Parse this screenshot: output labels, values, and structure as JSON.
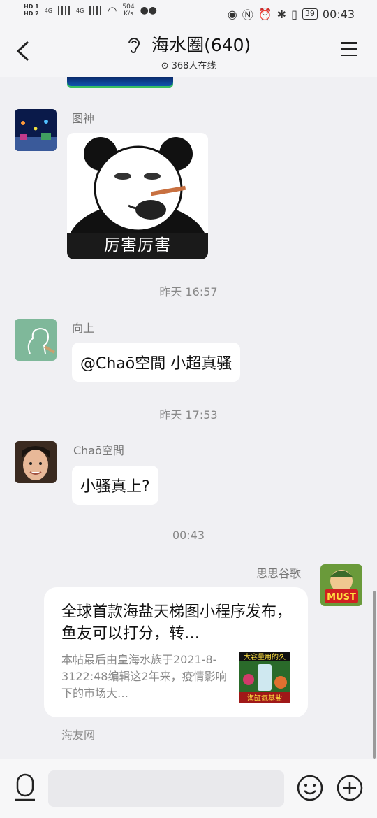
{
  "status_bar": {
    "hd1": "HD 1",
    "hd2": "HD 2",
    "net1": "4G",
    "net2": "4G",
    "speed_value": "504",
    "speed_unit": "K/s",
    "battery": "39",
    "time": "00:43"
  },
  "header": {
    "title": "海水圈(640)",
    "online": "368人在线"
  },
  "messages": [
    {
      "type": "sticker",
      "sender": "图神",
      "caption": "厉害厉害"
    },
    {
      "type": "time",
      "text": "昨天 16:57"
    },
    {
      "type": "text",
      "sender": "向上",
      "text": "@Chaō空間 小超真骚"
    },
    {
      "type": "time",
      "text": "昨天 17:53"
    },
    {
      "type": "text",
      "sender": "Chaō空間",
      "text": "小骚真上?"
    },
    {
      "type": "time",
      "text": "00:43"
    },
    {
      "type": "link_card",
      "sender": "思思谷歌",
      "title": "全球首款海盐天梯图小程序发布，鱼友可以打分，转…",
      "desc": "本帖最后由皇海水族于2021-8-3122:48编辑这2年来，疫情影响下的市场大…",
      "thumb_text": "大容量用的久",
      "thumb_banner": "海缸氮基盐",
      "source": "海友网"
    }
  ],
  "avatar_badge": "MUST",
  "colors": {
    "background": "#f0f0f3",
    "bubble": "#ffffff",
    "meta_text": "#888888"
  }
}
